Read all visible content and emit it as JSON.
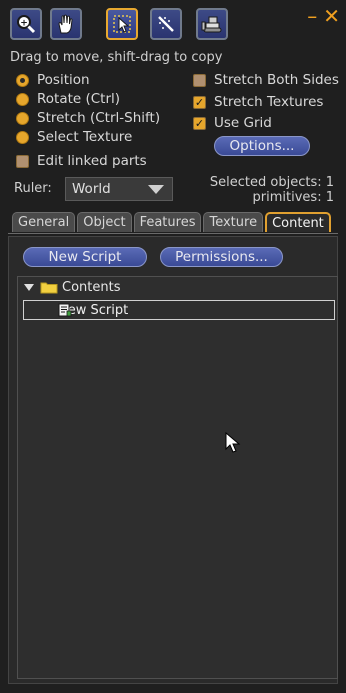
{
  "window": {
    "minimize_icon": "minimize-icon",
    "close_icon": "close-icon"
  },
  "tools": [
    {
      "name": "focus-tool",
      "icon": "magnifier-icon"
    },
    {
      "name": "move-tool",
      "icon": "hand-icon"
    },
    {
      "name": "edit-tool",
      "icon": "arrow-cursor-icon",
      "active": true
    },
    {
      "name": "create-tool",
      "icon": "magic-wand-icon"
    },
    {
      "name": "land-tool",
      "icon": "bulldozer-icon"
    }
  ],
  "hint_text": "Drag to move, shift-drag to copy",
  "modes": [
    {
      "label": "Position",
      "selected": true
    },
    {
      "label": "Rotate (Ctrl)",
      "selected": false
    },
    {
      "label": "Stretch (Ctrl-Shift)",
      "selected": false
    },
    {
      "label": "Select Texture",
      "selected": false
    }
  ],
  "edit_linked": {
    "label": "Edit linked parts",
    "checked": false
  },
  "options": {
    "stretch_both_sides": {
      "label": "Stretch Both Sides",
      "checked": false
    },
    "stretch_textures": {
      "label": "Stretch Textures",
      "checked": true
    },
    "use_grid": {
      "label": "Use Grid",
      "checked": true
    },
    "options_button": "Options..."
  },
  "ruler": {
    "label": "Ruler:",
    "value": "World"
  },
  "selection": {
    "objects": "Selected objects: 1",
    "primitives": "primitives: 1"
  },
  "tabs": [
    {
      "label": "General",
      "active": false
    },
    {
      "label": "Object",
      "active": false
    },
    {
      "label": "Features",
      "active": false
    },
    {
      "label": "Texture",
      "active": false
    },
    {
      "label": "Content",
      "active": true
    }
  ],
  "content": {
    "new_script_button": "New Script",
    "permissions_button": "Permissions...",
    "folder_label": "Contents",
    "items": [
      {
        "label": "New Script",
        "icon": "script-icon"
      }
    ]
  },
  "colors": {
    "accent": "#e8a930",
    "button": "#4a5aa6",
    "background": "#1f1f1f"
  }
}
